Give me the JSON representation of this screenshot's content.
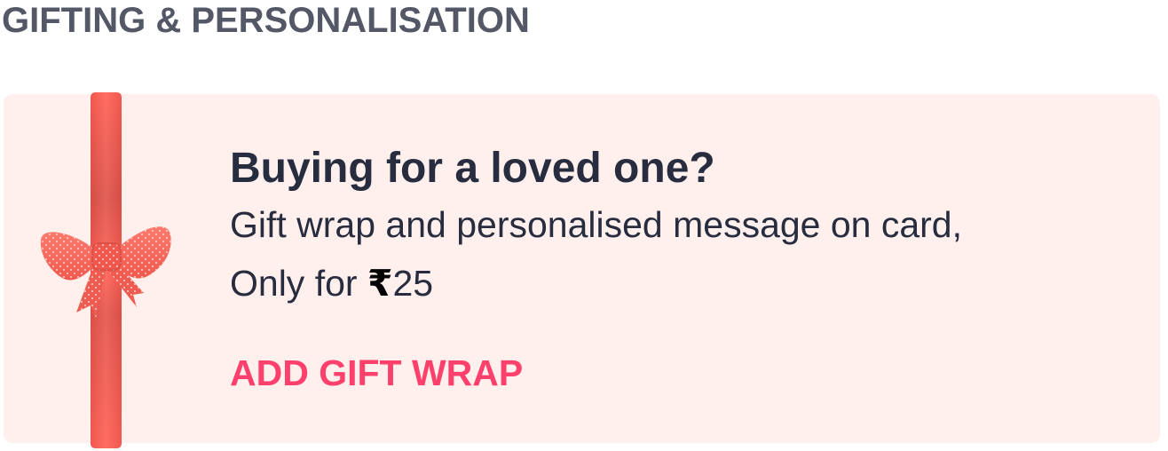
{
  "section": {
    "title": "GIFTING & PERSONALISATION"
  },
  "gift": {
    "headline": "Buying for a loved one?",
    "description": "Gift wrap and personalised message on card,",
    "price_prefix": "Only for ",
    "currency_symbol": "₹",
    "price": "25",
    "cta_label": "ADD GIFT WRAP",
    "icons": [
      "ribbon-icon",
      "bow-icon"
    ]
  },
  "colors": {
    "card_background": "#fff0ed",
    "ribbon": "#ff6b60",
    "cta": "#ff3f6c",
    "title": "#535766",
    "text": "#282c3f"
  }
}
